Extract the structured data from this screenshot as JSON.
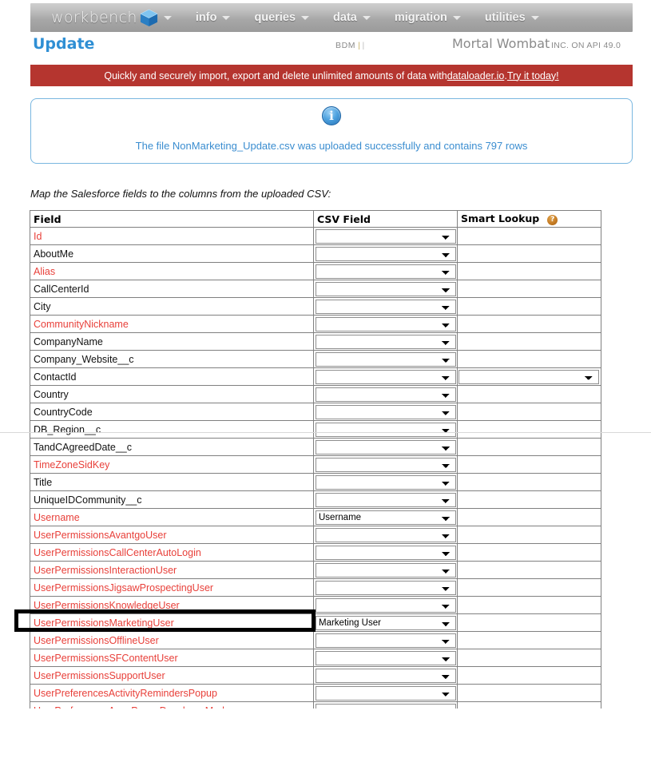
{
  "navbar": {
    "brand": "workbench",
    "brand_icon": "cube-icon",
    "brand_caret": "chevron-down-icon",
    "items": [
      {
        "label": "info",
        "caret": "chevron-down-icon"
      },
      {
        "label": "queries",
        "caret": "chevron-down-icon"
      },
      {
        "label": "data",
        "caret": "chevron-down-icon"
      },
      {
        "label": "migration",
        "caret": "chevron-down-icon"
      },
      {
        "label": "utilities",
        "caret": "chevron-down-icon"
      }
    ]
  },
  "header": {
    "page_title": "Update",
    "bdm_label": "BDM",
    "org_name": "Mortal Wombat",
    "api_info": "INC. ON API 49.0"
  },
  "promo": {
    "text_before": "Quickly and securely import, export and delete unlimited amounts of data with ",
    "link1": "dataloader.io",
    "text_middle": ". ",
    "link2": "Try it today!",
    "background_color": "#b5352f"
  },
  "callout": {
    "icon": "info-icon",
    "message": "The file NonMarketing_Update.csv was uploaded successfully and contains 797 rows",
    "file_name": "NonMarketing_Update.csv",
    "row_count": "797",
    "border_color": "#79b7e0",
    "text_color": "#3a8dd0"
  },
  "instruction": "Map the Salesforce fields to the columns from the uploaded CSV:",
  "table": {
    "columns": [
      "Field",
      "CSV Field",
      "Smart Lookup"
    ],
    "smart_lookup_help_icon": "help-question-icon",
    "required_color": "#e8403a",
    "rows": [
      {
        "field": "Id",
        "required": true,
        "csv_value": "",
        "smart_lookup": null
      },
      {
        "field": "AboutMe",
        "required": false,
        "csv_value": "",
        "smart_lookup": null
      },
      {
        "field": "Alias",
        "required": true,
        "csv_value": "",
        "smart_lookup": null
      },
      {
        "field": "CallCenterId",
        "required": false,
        "csv_value": "",
        "smart_lookup": null
      },
      {
        "field": "City",
        "required": false,
        "csv_value": "",
        "smart_lookup": null
      },
      {
        "field": "CommunityNickname",
        "required": true,
        "csv_value": "",
        "smart_lookup": null
      },
      {
        "field": "CompanyName",
        "required": false,
        "csv_value": "",
        "smart_lookup": null
      },
      {
        "field": "Company_Website__c",
        "required": false,
        "csv_value": "",
        "smart_lookup": null
      },
      {
        "field": "ContactId",
        "required": false,
        "csv_value": "",
        "smart_lookup": ""
      },
      {
        "field": "Country",
        "required": false,
        "csv_value": "",
        "smart_lookup": null
      },
      {
        "field": "CountryCode",
        "required": false,
        "csv_value": "",
        "smart_lookup": null
      },
      {
        "field": "DB_Region__c",
        "required": false,
        "csv_value": "",
        "smart_lookup": null
      },
      {
        "field": "TandCAgreedDate__c",
        "required": false,
        "csv_value": "",
        "smart_lookup": null
      },
      {
        "field": "TimeZoneSidKey",
        "required": true,
        "csv_value": "",
        "smart_lookup": null
      },
      {
        "field": "Title",
        "required": false,
        "csv_value": "",
        "smart_lookup": null
      },
      {
        "field": "UniqueIDCommunity__c",
        "required": false,
        "csv_value": "",
        "smart_lookup": null
      },
      {
        "field": "Username",
        "required": true,
        "csv_value": "Username",
        "smart_lookup": null
      },
      {
        "field": "UserPermissionsAvantgoUser",
        "required": true,
        "csv_value": "",
        "smart_lookup": null
      },
      {
        "field": "UserPermissionsCallCenterAutoLogin",
        "required": true,
        "csv_value": "",
        "smart_lookup": null
      },
      {
        "field": "UserPermissionsInteractionUser",
        "required": true,
        "csv_value": "",
        "smart_lookup": null
      },
      {
        "field": "UserPermissionsJigsawProspectingUser",
        "required": true,
        "csv_value": "",
        "smart_lookup": null
      },
      {
        "field": "UserPermissionsKnowledgeUser",
        "required": true,
        "csv_value": "",
        "smart_lookup": null
      },
      {
        "field": "UserPermissionsMarketingUser",
        "required": true,
        "csv_value": "Marketing User",
        "smart_lookup": null,
        "highlighted": true
      },
      {
        "field": "UserPermissionsOfflineUser",
        "required": true,
        "csv_value": "",
        "smart_lookup": null
      },
      {
        "field": "UserPermissionsSFContentUser",
        "required": true,
        "csv_value": "",
        "smart_lookup": null
      },
      {
        "field": "UserPermissionsSupportUser",
        "required": true,
        "csv_value": "",
        "smart_lookup": null
      },
      {
        "field": "UserPreferencesActivityRemindersPopup",
        "required": true,
        "csv_value": "",
        "smart_lookup": null
      },
      {
        "field": "UserPreferencesApexPagesDeveloperMode",
        "required": true,
        "csv_value": "",
        "smart_lookup": null
      }
    ]
  }
}
